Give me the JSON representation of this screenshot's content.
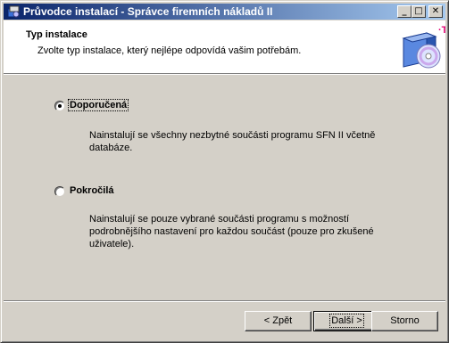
{
  "window": {
    "title": "Průvodce instalací - Správce firemních nákladů II",
    "controls": {
      "minimize": "_",
      "maximize": "□",
      "close": "✕"
    }
  },
  "header": {
    "title": "Typ instalace",
    "subtitle": "Zvolte typ instalace, který nejlépe odpovídá vašim potřebám.",
    "brand_mark": "·T·"
  },
  "options": [
    {
      "label": "Doporučená",
      "selected": true,
      "description_lines": [
        "Nainstalují se všechny nezbytné součásti programu SFN II včetně",
        "databáze."
      ]
    },
    {
      "label": "Pokročilá",
      "selected": false,
      "description_lines": [
        "Nainstalují se pouze vybrané součásti programu s možností",
        "podrobnějšího nastavení pro každou součást (pouze pro zkušené",
        "uživatele)."
      ]
    }
  ],
  "buttons": {
    "back": "< Zpět",
    "next": "Další >",
    "cancel": "Storno"
  },
  "colors": {
    "titlebar_start": "#0a246a",
    "titlebar_end": "#a6caf0",
    "brand_magenta": "#e20074"
  }
}
